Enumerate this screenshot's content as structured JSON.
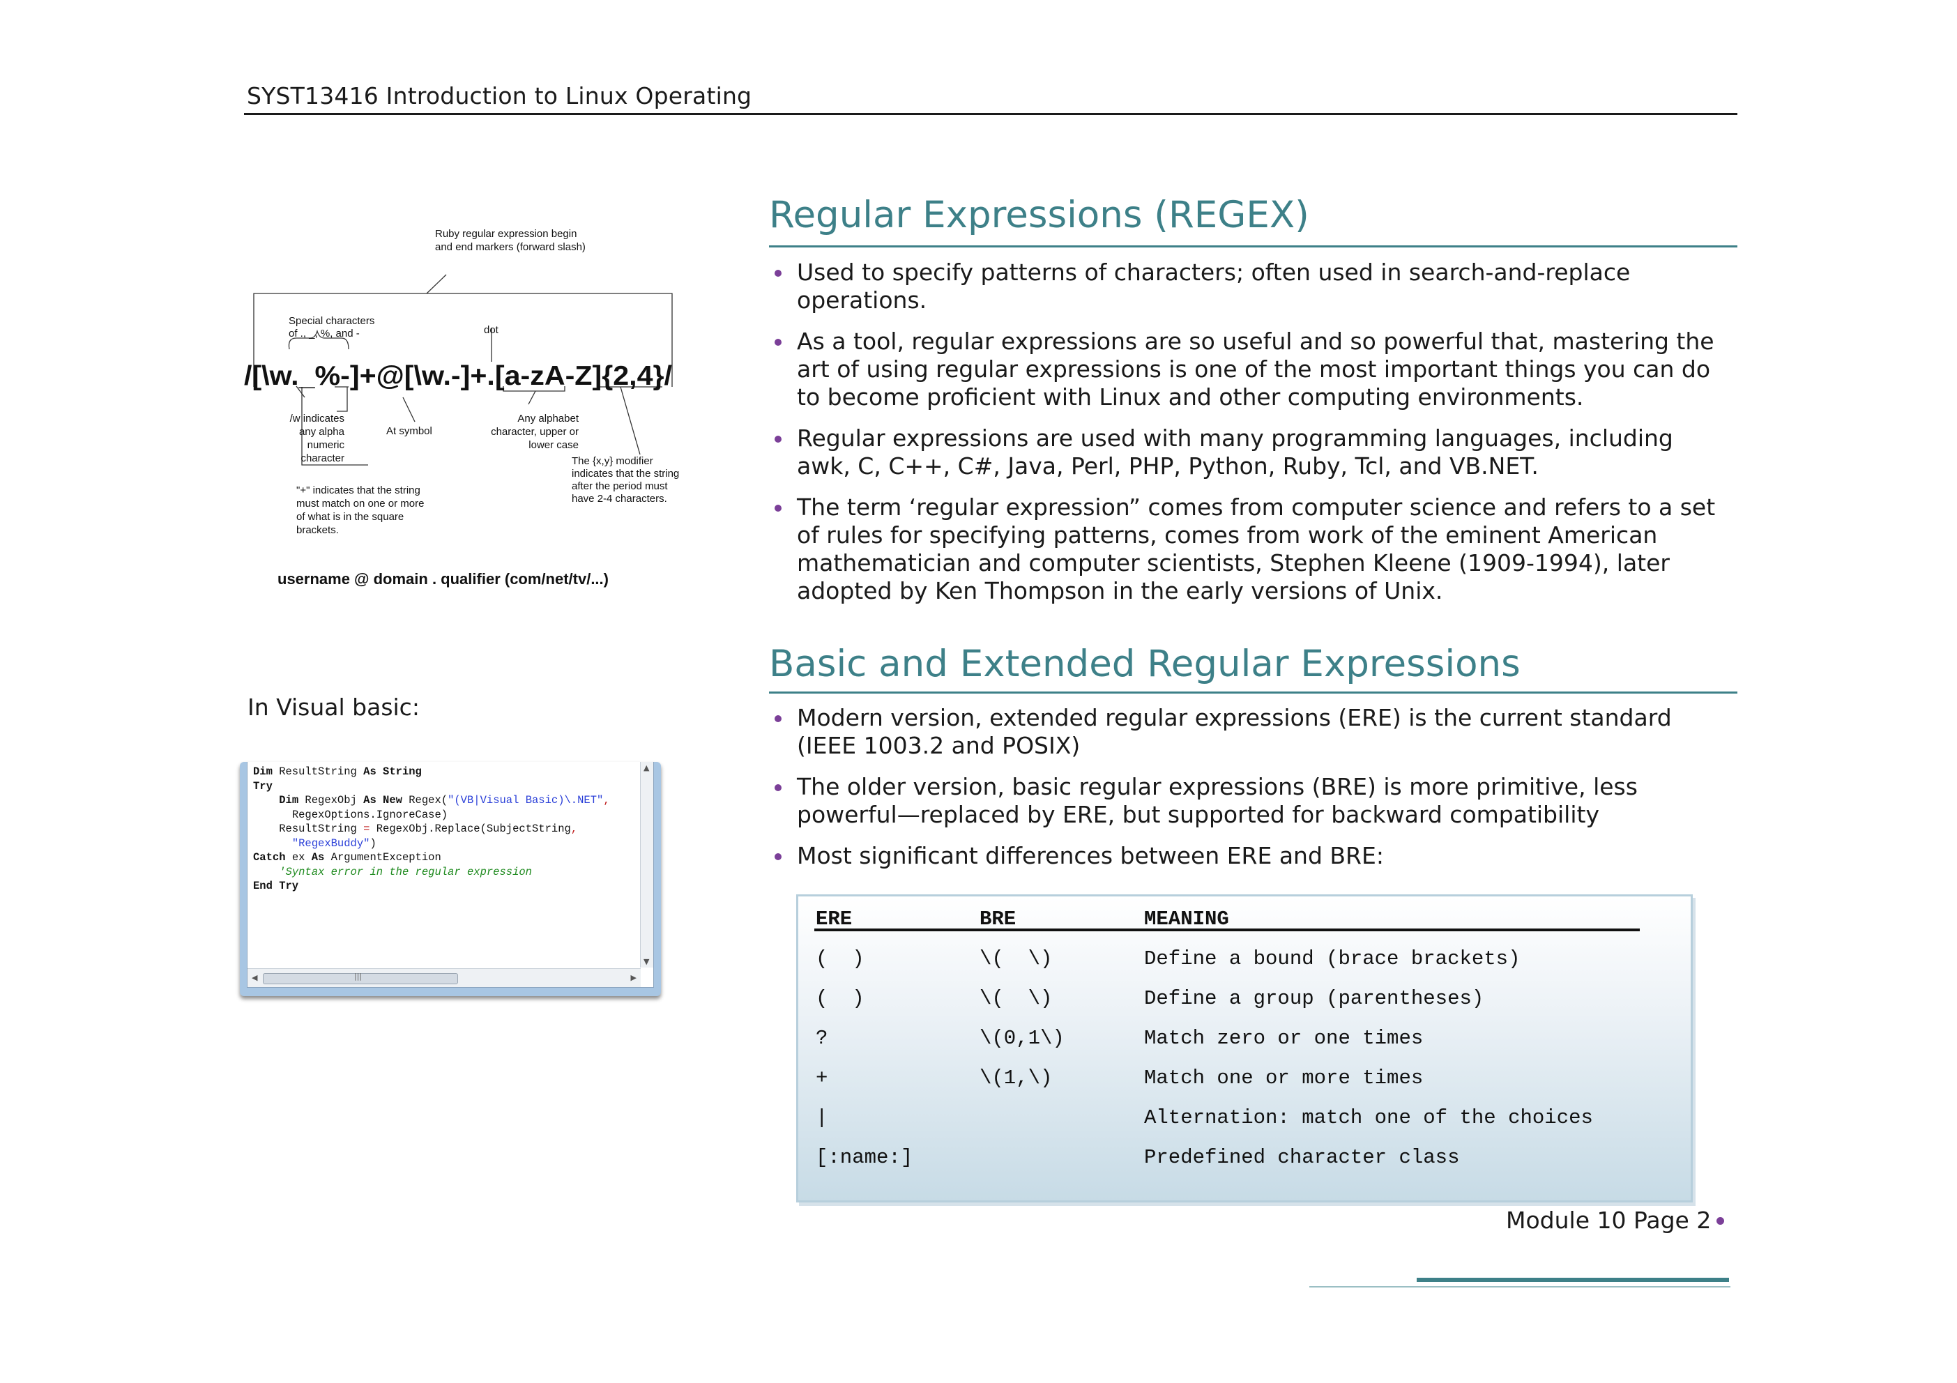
{
  "header": {
    "title": "SYST13416 Introduction to Linux Operating"
  },
  "section1": {
    "title": "Regular Expressions (REGEX)",
    "bullets": [
      "Used to specify patterns of characters; often used in search-and-replace operations.",
      "As a tool, regular expressions are so useful and so powerful that, mastering the art of using regular expressions is one of the most important things you can do to become proficient with Linux and other computing environments.",
      "Regular expressions are used with many programming languages, including awk, C, C++, C#, Java, Perl, PHP, Python, Ruby, Tcl, and VB.NET.",
      "The term ‘regular expression” comes from computer science and refers to a set of rules for specifying patterns, comes from work of the eminent American mathematician and computer scientists, Stephen Kleene (1909-1994), later adopted by Ken Thompson in the early versions of Unix."
    ]
  },
  "section2": {
    "title": "Basic and Extended Regular Expressions",
    "bullets": [
      "Modern version, extended regular expressions (ERE) is the current standard (IEEE 1003.2 and POSIX)",
      "The older version, basic regular expressions (BRE) is more primitive, less powerful—replaced by ERE, but supported for backward compatibility",
      "Most significant differences between ERE and BRE:"
    ]
  },
  "table": {
    "headers": [
      "ERE",
      "BRE",
      "MEANING"
    ],
    "rows": [
      [
        "(  )",
        "\\(  \\)",
        "Define a bound (brace brackets)"
      ],
      [
        "(  )",
        "\\(  \\)",
        "Define a group (parentheses)"
      ],
      [
        "?",
        "\\(0,1\\)",
        "Match zero or one times"
      ],
      [
        "+",
        "\\(1,\\)",
        "Match one or more times"
      ],
      [
        "|",
        "",
        "Alternation: match one of the choices"
      ],
      [
        "[:name:]",
        "",
        "Predefined character class"
      ]
    ]
  },
  "diagram": {
    "regex": "/[\\w._%-]+@[\\w.-]+.[a-zA-Z]{2,4}/",
    "label_markers_1": "Ruby regular expression begin",
    "label_markers_2": "and end markers (forward slash)",
    "label_special_1": "Special characters",
    "label_special_2": "of ., _, %, and -",
    "label_dot": "dot",
    "label_w_1": "/w indicates",
    "label_w_2": "any alpha",
    "label_w_3": "numeric",
    "label_w_4": "character",
    "label_at": "At symbol",
    "label_alpha_1": "Any alphabet",
    "label_alpha_2": "character, upper or",
    "label_alpha_3": "lower case",
    "label_mod_1": "The {x,y} modifier",
    "label_mod_2": "indicates that the string",
    "label_mod_3": "after the period must",
    "label_mod_4": "have 2-4 characters.",
    "label_plus_1": "\"+\" indicates that the string",
    "label_plus_2": "must match on one or more",
    "label_plus_3": "of what is in the square",
    "label_plus_4": "brackets.",
    "caption": "username @ domain . qualifier (com/net/tv/...)"
  },
  "vb": {
    "caption": "In Visual basic:",
    "code": {
      "l1_kw1": "Dim",
      "l1_mid": " ResultString ",
      "l1_kw2": "As String",
      "l2_kw": "Try",
      "l3_kw1": "Dim",
      "l3_mid1": " RegexObj ",
      "l3_kw2": "As New",
      "l3_mid2": " Regex(",
      "l3_str": "\"(VB|Visual Basic)\\.NET\"",
      "l3_end": ",",
      "l4": "RegexOptions.IgnoreCase)",
      "l5_a": "ResultString ",
      "l5_op": "=",
      "l5_b": " RegexObj.Replace(SubjectString",
      "l6_str": "\"RegexBuddy\"",
      "l6_end": ")",
      "l7_kw1": "Catch",
      "l7_mid": " ex ",
      "l7_kw2": "As",
      "l7_end": " ArgumentException",
      "l8_cmt": "'Syntax error in the regular expression",
      "l9_kw": "End Try"
    },
    "scroll_grip": "|||"
  },
  "footer": {
    "page_label": "Module 10 Page 2"
  },
  "colors": {
    "accent_teal": "#3d8088",
    "bullet_purple": "#7b3f98"
  }
}
